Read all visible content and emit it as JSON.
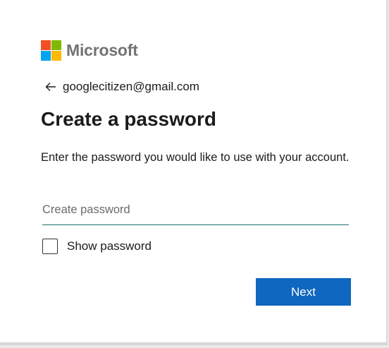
{
  "brand": {
    "name": "Microsoft",
    "colors": [
      "#f25022",
      "#7fba00",
      "#00a4ef",
      "#ffb900"
    ]
  },
  "identity": {
    "back_icon": "arrow-left-icon",
    "email": "googlecitizen@gmail.com"
  },
  "page": {
    "title": "Create a password",
    "description": "Enter the password you would like to use with your account."
  },
  "password_field": {
    "placeholder": "Create password",
    "value": ""
  },
  "show_password": {
    "label": "Show password",
    "checked": false
  },
  "actions": {
    "next_label": "Next",
    "accent_color": "#0f67bf"
  }
}
